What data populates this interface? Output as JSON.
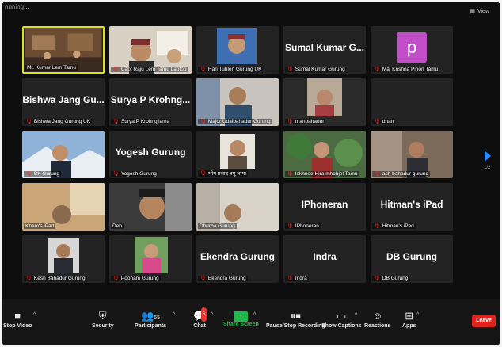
{
  "topbar": {
    "status": "nnning...",
    "view_label": "View"
  },
  "tiles": [
    {
      "id": "t1",
      "name": "Mr. Kumar Lem Tamu",
      "big": "",
      "mic_muted": false
    },
    {
      "id": "t2",
      "name": "Capt Raju Lem Tamu Laptop",
      "big": "",
      "mic_muted": true
    },
    {
      "id": "t3",
      "name": "Hari Tuhlen Gurung UK",
      "big": "",
      "mic_muted": true
    },
    {
      "id": "t4",
      "name": "Sumal Kumar Gurung",
      "big": "Sumal Kumar G...",
      "mic_muted": true
    },
    {
      "id": "t5",
      "name": "Maj Krishna Pihon Tamu",
      "big": "",
      "mic_muted": true,
      "avatar": "p"
    },
    {
      "id": "t6",
      "name": "Bishwa Jang Gurung UK",
      "big": "Bishwa Jang Gu...",
      "mic_muted": true
    },
    {
      "id": "t7",
      "name": "Surya P Krohngilama",
      "big": "Surya P Krohng...",
      "mic_muted": true
    },
    {
      "id": "t8",
      "name": "Major Udaibahadur Gurung",
      "big": "",
      "mic_muted": true
    },
    {
      "id": "t9",
      "name": "manbahadur",
      "big": "",
      "mic_muted": true
    },
    {
      "id": "t10",
      "name": "dhan",
      "big": "",
      "mic_muted": true
    },
    {
      "id": "t11",
      "name": "BK Gurung",
      "big": "",
      "mic_muted": true
    },
    {
      "id": "t12",
      "name": "Yogesh Gurung",
      "big": "Yogesh Gurung",
      "mic_muted": true
    },
    {
      "id": "t13",
      "name": "भीम प्रसाद तमु लामा",
      "big": "",
      "mic_muted": true
    },
    {
      "id": "t14",
      "name": "lekhnee Hira mhobjel Tamu",
      "big": "",
      "mic_muted": true
    },
    {
      "id": "t15",
      "name": "ash bahadur gurung",
      "big": "",
      "mic_muted": true
    },
    {
      "id": "t16",
      "name": "Kham's iPad",
      "big": "",
      "mic_muted": false
    },
    {
      "id": "t17",
      "name": "Deb",
      "big": "",
      "mic_muted": false
    },
    {
      "id": "t18",
      "name": "Dhurba Gurung",
      "big": "",
      "mic_muted": false
    },
    {
      "id": "t19",
      "name": "IPhoneran",
      "big": "IPhoneran",
      "mic_muted": true
    },
    {
      "id": "t20",
      "name": "Hitman's iPad",
      "big": "Hitman's iPad",
      "mic_muted": true
    },
    {
      "id": "t21",
      "name": "Kesh Bahadur Gurung",
      "big": "",
      "mic_muted": true
    },
    {
      "id": "t22",
      "name": "Poonam Gurung",
      "big": "",
      "mic_muted": true
    },
    {
      "id": "t23",
      "name": "Ekendra Gurung",
      "big": "Ekendra Gurung",
      "mic_muted": true
    },
    {
      "id": "t24",
      "name": "Indra",
      "big": "Indra",
      "mic_muted": true
    },
    {
      "id": "t25",
      "name": "DB Gurung",
      "big": "DB Gurung",
      "mic_muted": true
    }
  ],
  "pager": {
    "indicator": "1/2"
  },
  "toolbar": {
    "stop_video": "Stop Video",
    "security": "Security",
    "participants": "Participants",
    "participants_count": "55",
    "chat": "Chat",
    "chat_badge": "5",
    "share_screen": "Share Screen",
    "recording": "Pause/Stop Recording",
    "captions": "Show Captions",
    "reactions": "Reactions",
    "apps": "Apps",
    "leave": "Leave"
  }
}
